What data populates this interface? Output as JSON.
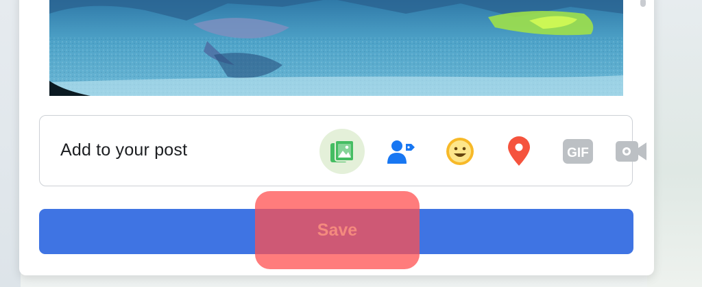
{
  "composer": {
    "add_to_post_label": "Add to your post",
    "icons": [
      {
        "name": "photo-video-icon",
        "color": "#45bd62",
        "active": true
      },
      {
        "name": "tag-people-icon",
        "color": "#1877f2"
      },
      {
        "name": "feeling-activity-icon",
        "color": "#f7b928"
      },
      {
        "name": "check-in-icon",
        "color": "#f5533d"
      },
      {
        "name": "gif-icon",
        "color": "#bcc0c4",
        "text": "GIF"
      },
      {
        "name": "live-video-icon",
        "color": "#bcc0c4"
      }
    ],
    "save_label": "Save"
  },
  "colors": {
    "accent": "#3f74e3",
    "highlight": "#ff5050",
    "active_icon_bg": "#e4f0d9"
  }
}
